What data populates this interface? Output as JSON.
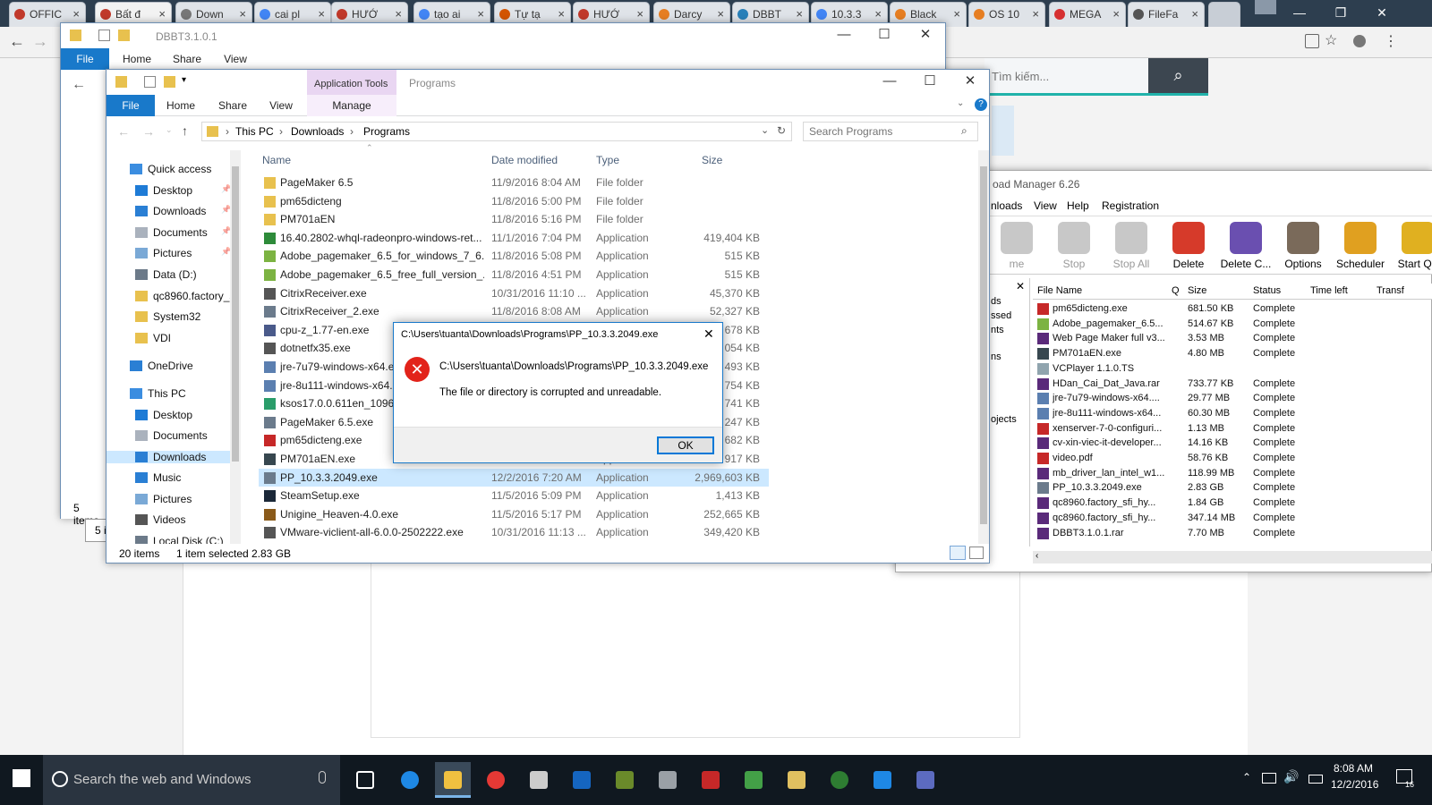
{
  "browser": {
    "tabs": [
      {
        "label": "OFFIC",
        "color": "#c0392b"
      },
      {
        "label": "Bất đ",
        "color": "#c0392b"
      },
      {
        "label": "Down",
        "color": "#777777"
      },
      {
        "label": "cai pl",
        "color": "#4285f4"
      },
      {
        "label": "HƯỚ",
        "color": "#c0392b"
      },
      {
        "label": "tạo ai",
        "color": "#4285f4"
      },
      {
        "label": "Tự tạ",
        "color": "#d35400"
      },
      {
        "label": "HƯỚ",
        "color": "#c0392b"
      },
      {
        "label": "Darcy",
        "color": "#e67e22"
      },
      {
        "label": "DBBT",
        "color": "#2980b9"
      },
      {
        "label": "10.3.3",
        "color": "#4285f4"
      },
      {
        "label": "Black",
        "color": "#e67e22"
      },
      {
        "label": "OS 10",
        "color": "#e67e22"
      },
      {
        "label": "MEGA",
        "color": "#d63031"
      },
      {
        "label": "FileFa",
        "color": "#555555"
      }
    ],
    "tab_close": "×",
    "search_placeholder": "Tìm kiếm..."
  },
  "explorer_back": {
    "title": "DBBT3.1.0.1",
    "tabs": {
      "file": "File",
      "home": "Home",
      "share": "Share",
      "view": "View"
    },
    "status": "5 items",
    "status2": "5 i"
  },
  "explorer": {
    "context_tab": "Application Tools",
    "context_title": "Programs",
    "tabs": {
      "file": "File",
      "home": "Home",
      "share": "Share",
      "view": "View",
      "manage": "Manage"
    },
    "breadcrumb": [
      "This PC",
      "Downloads",
      "Programs"
    ],
    "search_placeholder": "Search Programs",
    "columns": {
      "name": "Name",
      "date": "Date modified",
      "type": "Type",
      "size": "Size"
    },
    "nav": [
      {
        "label": "Quick access",
        "kind": "star"
      },
      {
        "label": "Desktop",
        "kind": "desk",
        "pin": "📌"
      },
      {
        "label": "Downloads",
        "kind": "down",
        "pin": "📌"
      },
      {
        "label": "Documents",
        "kind": "doc",
        "pin": "📌"
      },
      {
        "label": "Pictures",
        "kind": "pic",
        "pin": "📌"
      },
      {
        "label": "Data (D:)",
        "kind": "drive"
      },
      {
        "label": "qc8960.factory_s",
        "kind": "folder"
      },
      {
        "label": "System32",
        "kind": "folder"
      },
      {
        "label": "VDI",
        "kind": "folder"
      },
      {
        "label": "OneDrive",
        "kind": "cloud"
      },
      {
        "label": "This PC",
        "kind": "pc"
      },
      {
        "label": "Desktop",
        "kind": "desk"
      },
      {
        "label": "Documents",
        "kind": "doc"
      },
      {
        "label": "Downloads",
        "kind": "down"
      },
      {
        "label": "Music",
        "kind": "music"
      },
      {
        "label": "Pictures",
        "kind": "pic"
      },
      {
        "label": "Videos",
        "kind": "video"
      },
      {
        "label": "Local Disk (C:)",
        "kind": "drive"
      }
    ],
    "files": [
      {
        "name": "PageMaker 6.5",
        "date": "11/9/2016 8:04 AM",
        "type": "File folder",
        "size": "",
        "icon": "#e8c14e"
      },
      {
        "name": "pm65dicteng",
        "date": "11/8/2016 5:00 PM",
        "type": "File folder",
        "size": "",
        "icon": "#e8c14e"
      },
      {
        "name": "PM701aEN",
        "date": "11/8/2016 5:16 PM",
        "type": "File folder",
        "size": "",
        "icon": "#e8c14e"
      },
      {
        "name": "16.40.2802-whql-radeonpro-windows-ret...",
        "date": "11/1/2016 7:04 PM",
        "type": "Application",
        "size": "419,404 KB",
        "icon": "#2e8b3a"
      },
      {
        "name": "Adobe_pagemaker_6.5_for_windows_7_6...",
        "date": "11/8/2016 5:08 PM",
        "type": "Application",
        "size": "515 KB",
        "icon": "#7cb342"
      },
      {
        "name": "Adobe_pagemaker_6.5_free_full_version_...",
        "date": "11/8/2016 4:51 PM",
        "type": "Application",
        "size": "515 KB",
        "icon": "#7cb342"
      },
      {
        "name": "CitrixReceiver.exe",
        "date": "10/31/2016 11:10 ...",
        "type": "Application",
        "size": "45,370 KB",
        "icon": "#555555"
      },
      {
        "name": "CitrixReceiver_2.exe",
        "date": "11/8/2016 8:08 AM",
        "type": "Application",
        "size": "52,327 KB",
        "icon": "#6b7b8c"
      },
      {
        "name": "cpu-z_1.77-en.exe",
        "date": "",
        "type": "",
        "size": "678 KB",
        "icon": "#4a5a8a"
      },
      {
        "name": "dotnetfx35.exe",
        "date": "",
        "type": "",
        "size": "054 KB",
        "icon": "#555555"
      },
      {
        "name": "jre-7u79-windows-x64.ex",
        "date": "",
        "type": "",
        "size": "493 KB",
        "icon": "#5b7fb0"
      },
      {
        "name": "jre-8u111-windows-x64.e",
        "date": "",
        "type": "",
        "size": "754 KB",
        "icon": "#5b7fb0"
      },
      {
        "name": "ksos17.0.0.611en_10962.e",
        "date": "",
        "type": "",
        "size": "741 KB",
        "icon": "#2a9d6a"
      },
      {
        "name": "PageMaker 6.5.exe",
        "date": "",
        "type": "",
        "size": "247 KB",
        "icon": "#6b7b8c"
      },
      {
        "name": "pm65dicteng.exe",
        "date": "",
        "type": "",
        "size": "682 KB",
        "icon": "#c62828"
      },
      {
        "name": "PM701aEN.exe",
        "date": "",
        "type": "Application",
        "size": "917 KB",
        "icon": "#37474f"
      },
      {
        "name": "PP_10.3.3.2049.exe",
        "date": "12/2/2016 7:20 AM",
        "type": "Application",
        "size": "2,969,603 KB",
        "icon": "#6b7b8c",
        "selected": true
      },
      {
        "name": "SteamSetup.exe",
        "date": "11/5/2016 5:09 PM",
        "type": "Application",
        "size": "1,413 KB",
        "icon": "#1b2838"
      },
      {
        "name": "Unigine_Heaven-4.0.exe",
        "date": "11/5/2016 5:17 PM",
        "type": "Application",
        "size": "252,665 KB",
        "icon": "#8a5a1a"
      },
      {
        "name": "VMware-viclient-all-6.0.0-2502222.exe",
        "date": "10/31/2016 11:13 ...",
        "type": "Application",
        "size": "349,420 KB",
        "icon": "#555555"
      }
    ],
    "status": {
      "items": "20 items",
      "selected": "1 item selected",
      "size": "2.83 GB"
    }
  },
  "dialog": {
    "title": "C:\\Users\\tuanta\\Downloads\\Programs\\PP_10.3.3.2049.exe",
    "path": "C:\\Users\\tuanta\\Downloads\\Programs\\PP_10.3.3.2049.exe",
    "message": "The file or directory is corrupted and unreadable.",
    "ok": "OK"
  },
  "idm": {
    "title": "oad Manager 6.26",
    "menu": [
      "nloads",
      "View",
      "Help",
      "Registration"
    ],
    "toolbar": [
      {
        "label": "me",
        "color": "#c8c8c8"
      },
      {
        "label": "Stop",
        "color": "#c8c8c8"
      },
      {
        "label": "Stop All",
        "color": "#c8c8c8"
      },
      {
        "label": "Delete",
        "color": "#d63a2a"
      },
      {
        "label": "Delete C...",
        "color": "#6a4fb0"
      },
      {
        "label": "Options",
        "color": "#7a6a5a"
      },
      {
        "label": "Scheduler",
        "color": "#e0a020"
      },
      {
        "label": "Start Qu",
        "color": "#e0b020"
      }
    ],
    "side": [
      "ds",
      "ssed",
      "nts",
      "ns",
      "ojects"
    ],
    "columns": {
      "name": "File Name",
      "q": "Q",
      "size": "Size",
      "status": "Status",
      "time": "Time left",
      "transfer": "Transf"
    },
    "rows": [
      {
        "name": "pm65dicteng.exe",
        "size": "681.50 KB",
        "status": "Complete",
        "icon": "#c62828"
      },
      {
        "name": "Adobe_pagemaker_6.5...",
        "size": "514.67 KB",
        "status": "Complete",
        "icon": "#7cb342"
      },
      {
        "name": "Web Page Maker full v3...",
        "size": "3.53 MB",
        "status": "Complete",
        "icon": "#5a2a7a"
      },
      {
        "name": "PM701aEN.exe",
        "size": "4.80 MB",
        "status": "Complete",
        "icon": "#37474f"
      },
      {
        "name": "VCPlayer 1.1.0.TS",
        "size": "",
        "status": "",
        "icon": "#90a4ae"
      },
      {
        "name": "HDan_Cai_Dat_Java.rar",
        "size": "733.77 KB",
        "status": "Complete",
        "icon": "#5a2a7a"
      },
      {
        "name": "jre-7u79-windows-x64....",
        "size": "29.77 MB",
        "status": "Complete",
        "icon": "#5b7fb0"
      },
      {
        "name": "jre-8u111-windows-x64...",
        "size": "60.30 MB",
        "status": "Complete",
        "icon": "#5b7fb0"
      },
      {
        "name": "xenserver-7-0-configuri...",
        "size": "1.13 MB",
        "status": "Complete",
        "icon": "#c62828"
      },
      {
        "name": "cv-xin-viec-it-developer...",
        "size": "14.16 KB",
        "status": "Complete",
        "icon": "#5a2a7a"
      },
      {
        "name": "video.pdf",
        "size": "58.76 KB",
        "status": "Complete",
        "icon": "#c62828"
      },
      {
        "name": "mb_driver_lan_intel_w1...",
        "size": "118.99 MB",
        "status": "Complete",
        "icon": "#5a2a7a"
      },
      {
        "name": "PP_10.3.3.2049.exe",
        "size": "2.83 GB",
        "status": "Complete",
        "icon": "#6b7b8c"
      },
      {
        "name": "qc8960.factory_sfi_hy...",
        "size": "1.84 GB",
        "status": "Complete",
        "icon": "#5a2a7a"
      },
      {
        "name": "qc8960.factory_sfi_hy...",
        "size": "347.14 MB",
        "status": "Complete",
        "icon": "#5a2a7a"
      },
      {
        "name": "DBBT3.1.0.1.rar",
        "size": "7.70 MB",
        "status": "Complete",
        "icon": "#5a2a7a"
      }
    ]
  },
  "taskbar": {
    "search_placeholder": "Search the web and Windows",
    "time": "8:08 AM",
    "date": "12/2/2016",
    "notif": "16",
    "apps": [
      {
        "name": "task-view",
        "color": "#ffffff"
      },
      {
        "name": "edge",
        "color": "#1e88e5"
      },
      {
        "name": "file-explorer",
        "color": "#f0c040",
        "active": true
      },
      {
        "name": "chrome",
        "color": "#e53935"
      },
      {
        "name": "app-c",
        "color": "#cccccc"
      },
      {
        "name": "outlook",
        "color": "#1565c0"
      },
      {
        "name": "app-green",
        "color": "#6a8a2a"
      },
      {
        "name": "app-image",
        "color": "#9aa0a6"
      },
      {
        "name": "app-red",
        "color": "#c62828"
      },
      {
        "name": "app-lime",
        "color": "#43a047"
      },
      {
        "name": "app-yellow",
        "color": "#e0c060"
      },
      {
        "name": "app-globe",
        "color": "#2e7d32"
      },
      {
        "name": "app-blue",
        "color": "#1e88e5"
      },
      {
        "name": "app-purple",
        "color": "#5c6bc0"
      }
    ]
  }
}
